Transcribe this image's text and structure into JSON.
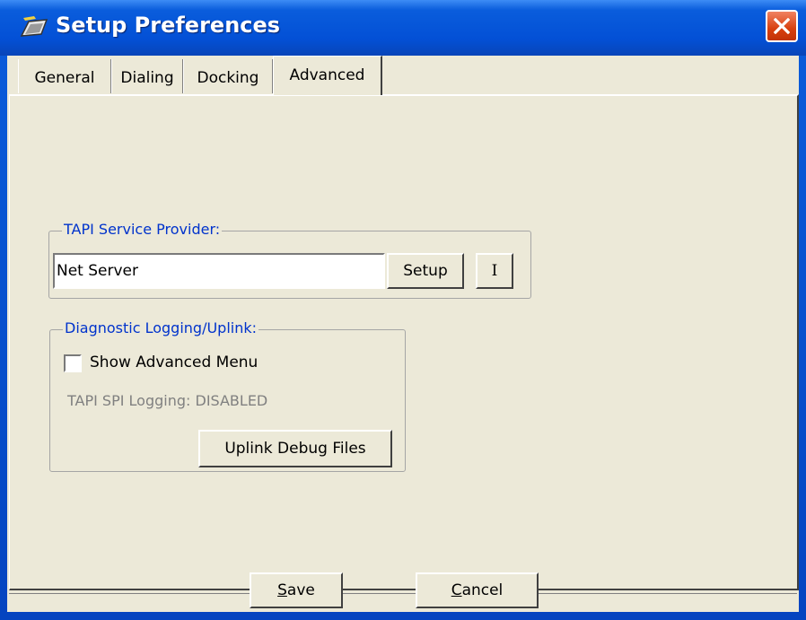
{
  "window": {
    "title": "Setup Preferences",
    "icon": "app-phone-icon",
    "close_icon": "close-icon",
    "accent_color": "#0a5ddc"
  },
  "tabs": [
    {
      "label": "General",
      "active": false
    },
    {
      "label": "Dialing",
      "active": false
    },
    {
      "label": "Docking",
      "active": false
    },
    {
      "label": "Advanced",
      "active": true
    }
  ],
  "tapi": {
    "legend": "TAPI Service Provider:",
    "value": "Net Server",
    "setup_label": "Setup",
    "info_label": "I"
  },
  "diagnostics": {
    "legend": "Diagnostic Logging/Uplink:",
    "show_advanced_label": "Show Advanced Menu",
    "show_advanced_checked": false,
    "spi_status": "TAPI SPI Logging: DISABLED",
    "uplink_label": "Uplink Debug Files"
  },
  "footer": {
    "save_first": "S",
    "save_rest": "ave",
    "cancel_first": "C",
    "cancel_rest": "ancel"
  }
}
